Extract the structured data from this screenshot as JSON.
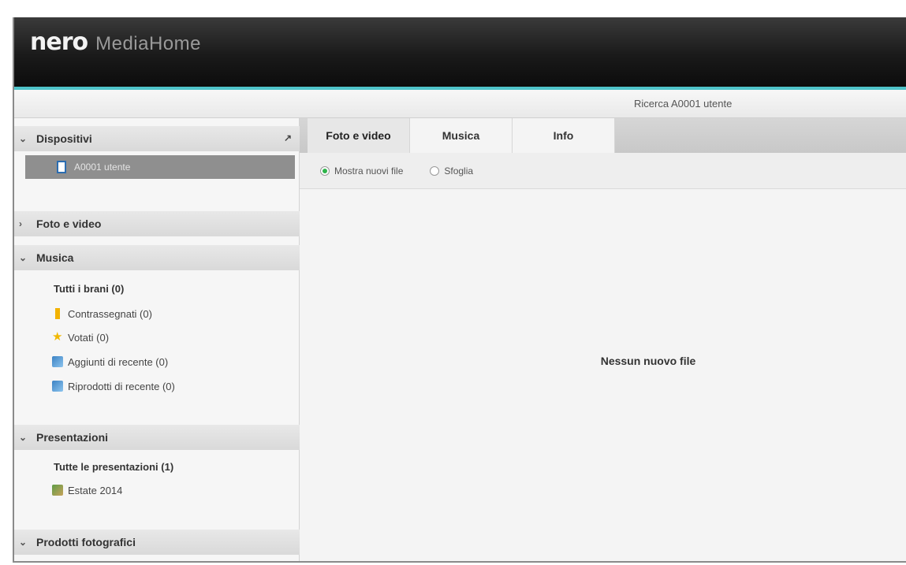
{
  "app": {
    "brand": "nero",
    "product": "MediaHome",
    "status_text": "Ricerca A0001 utente",
    "accent_color": "#4fc3c9"
  },
  "sidebar": {
    "devices_header": "Dispositivi",
    "device_item": "A0001 utente",
    "photos_header": "Foto e video",
    "music_header": "Musica",
    "music_items": [
      {
        "label": "Tutti i brani (0)",
        "icon": "none"
      },
      {
        "label": "Contrassegnati (0)",
        "icon": "bookmark-icon"
      },
      {
        "label": "Votati (0)",
        "icon": "star-icon"
      },
      {
        "label": "Aggiunti di recente (0)",
        "icon": "music-icon"
      },
      {
        "label": "Riprodotti di recente (0)",
        "icon": "music-icon"
      }
    ],
    "presentations_header": "Presentazioni",
    "presentation_items": [
      {
        "label": "Tutte le presentazioni (1)",
        "icon": "none"
      },
      {
        "label": "Estate 2014",
        "icon": "slideshow-icon"
      }
    ],
    "photo_products_header": "Prodotti fotografici"
  },
  "tabs": [
    {
      "label": "Foto e video",
      "active": true
    },
    {
      "label": "Musica",
      "active": false
    },
    {
      "label": "Info",
      "active": false
    }
  ],
  "filters": {
    "show_new": "Mostra nuovi file",
    "browse": "Sfoglia",
    "selected": "show_new"
  },
  "content": {
    "empty_message": "Nessun nuovo file"
  }
}
